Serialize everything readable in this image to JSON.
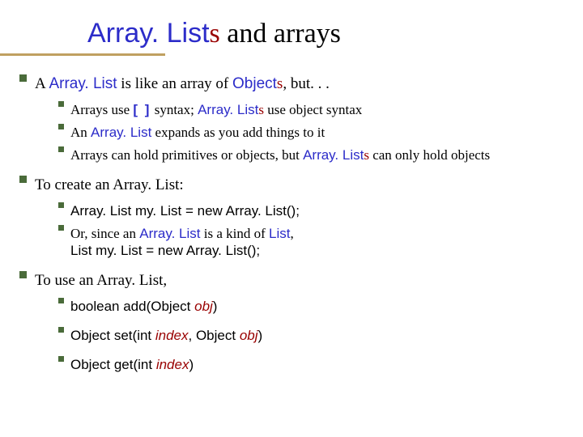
{
  "title": {
    "prefix": "Array. List",
    "suffix_s": "s",
    "rest": " and arrays"
  },
  "p1": {
    "a": "A ",
    "cls": "Array. List",
    "b": " is like an array of ",
    "objcls": "Object",
    "s": "s",
    "c": ", but. . ."
  },
  "p1sub": {
    "i1_a": "Arrays use ",
    "i1_br": "[ ]",
    "i1_b": " syntax; ",
    "i1_cls": "Array. List",
    "i1_s": "s",
    "i1_c": " use object syntax",
    "i2_a": "An  ",
    "i2_cls": "Array. List",
    "i2_b": " expands as you add things to it",
    "i3_a": "Arrays can hold primitives or objects, but ",
    "i3_cls": "Array. List",
    "i3_s": "s",
    "i3_b": " can only hold objects"
  },
  "p2": "To create an Array. List:",
  "p2sub": {
    "i1": "Array. List my. List = new Array. List();",
    "i2_a": "Or, since an ",
    "i2_cls": "Array. List",
    "i2_b": " is a kind of ",
    "i2_list": "List",
    "i2_c": ",",
    "i2_code": "List my. List = new Array. List();"
  },
  "p3": "To use an Array. List,",
  "p3sub": {
    "i1_a": "boolean add(Object ",
    "i1_obj": "obj",
    "i1_b": ")",
    "i2_a": "Object set(int ",
    "i2_idx": "index",
    "i2_b": ", Object ",
    "i2_obj": "obj",
    "i2_c": ")",
    "i3_a": "Object get(int ",
    "i3_idx": "index",
    "i3_b": ")"
  }
}
